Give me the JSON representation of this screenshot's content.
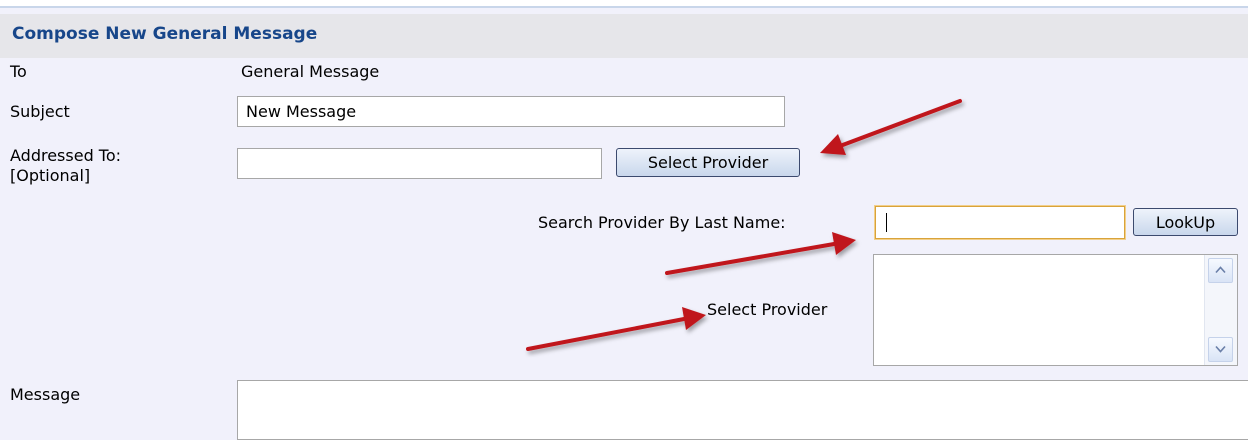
{
  "header": {
    "title": "Compose New General Message"
  },
  "form": {
    "to_label": "To",
    "to_value": "General Message",
    "subject_label": "Subject",
    "subject_value": "New Message",
    "addressed_to_label_line1": "Addressed To:",
    "addressed_to_label_line2": "[Optional]",
    "addressed_to_value": "",
    "select_provider_button": "Select Provider",
    "search_label": "Search Provider By Last Name:",
    "search_value": "",
    "lookup_button": "LookUp",
    "select_provider_label": "Select Provider",
    "message_label": "Message"
  },
  "colors": {
    "header_title": "#17468a",
    "header_background": "#e6e6ea",
    "page_background": "#f1f1fb",
    "annotation_arrow": "#c0161b",
    "focus_border": "#d9a33a"
  },
  "icons": {
    "scroll_up": "chevron-up-icon",
    "scroll_down": "chevron-down-icon",
    "annotations": "arrow-icon"
  }
}
